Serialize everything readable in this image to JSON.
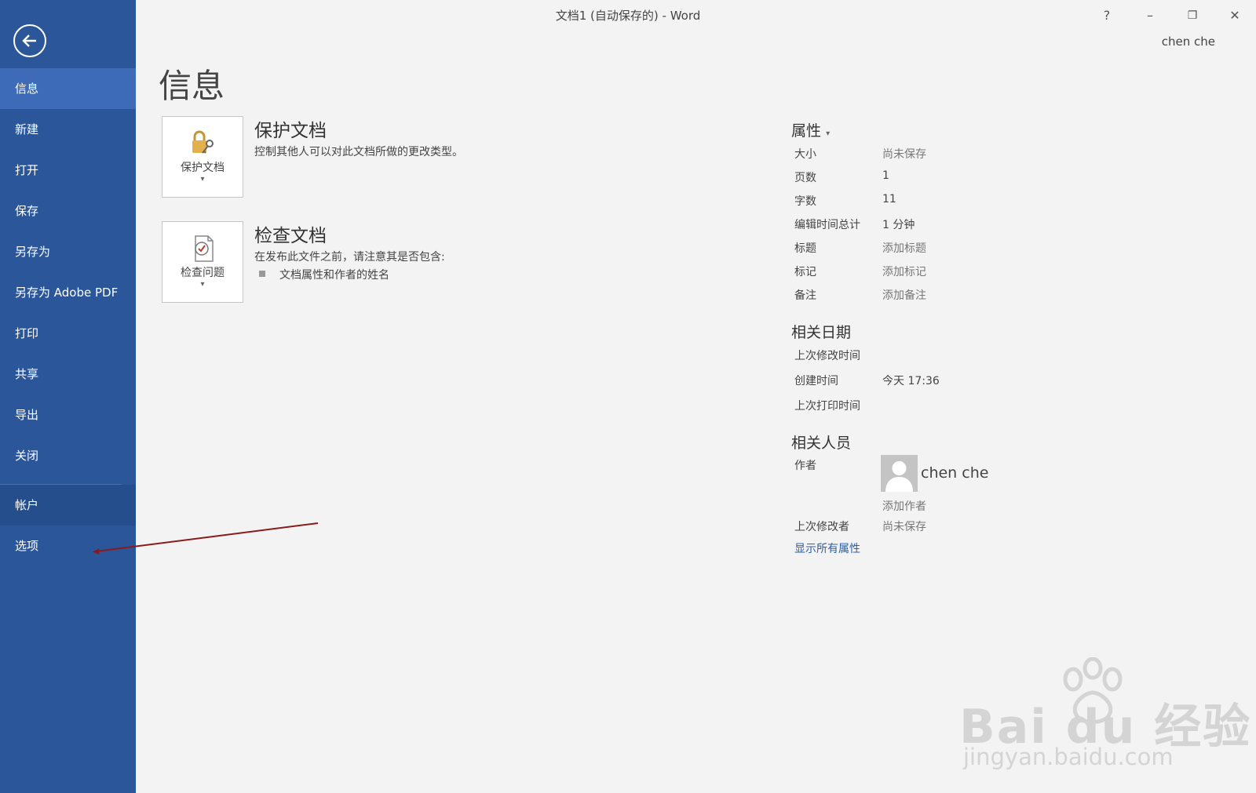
{
  "titlebar": {
    "title": "文档1 (自动保存的) - Word",
    "help": "?",
    "minimize": "–",
    "restore": "❐",
    "close": "✕",
    "user": "chen che"
  },
  "sidebar": {
    "items": [
      {
        "label": "信息"
      },
      {
        "label": "新建"
      },
      {
        "label": "打开"
      },
      {
        "label": "保存"
      },
      {
        "label": "另存为"
      },
      {
        "label": "另存为 Adobe PDF"
      },
      {
        "label": "打印"
      },
      {
        "label": "共享"
      },
      {
        "label": "导出"
      },
      {
        "label": "关闭"
      },
      {
        "label": "帐户"
      },
      {
        "label": "选项"
      }
    ]
  },
  "main": {
    "title": "信息",
    "protect": {
      "tile_label": "保护文档",
      "caret": "▾",
      "heading": "保护文档",
      "desc": "控制其他人可以对此文档所做的更改类型。"
    },
    "inspect": {
      "tile_label": "检查问题",
      "caret": "▾",
      "heading": "检查文档",
      "desc": "在发布此文件之前，请注意其是否包含:",
      "bullet": "文档属性和作者的姓名"
    }
  },
  "properties": {
    "heading": "属性",
    "heading_caret": "▾",
    "rows": [
      {
        "label": "大小",
        "value": "尚未保存"
      },
      {
        "label": "页数",
        "value": "1"
      },
      {
        "label": "字数",
        "value": "11"
      },
      {
        "label": "编辑时间总计",
        "value": "1 分钟"
      },
      {
        "label": "标题",
        "value": "添加标题"
      },
      {
        "label": "标记",
        "value": "添加标记"
      },
      {
        "label": "备注",
        "value": "添加备注"
      }
    ],
    "dates_heading": "相关日期",
    "dates": [
      {
        "label": "上次修改时间",
        "value": ""
      },
      {
        "label": "创建时间",
        "value": "今天 17:36"
      },
      {
        "label": "上次打印时间",
        "value": ""
      }
    ],
    "people_heading": "相关人员",
    "author_label": "作者",
    "author_name": "chen che",
    "add_author": "添加作者",
    "last_modified_by_label": "上次修改者",
    "last_modified_by_value": "尚未保存",
    "show_all": "显示所有属性"
  },
  "watermark": {
    "logo": "Bai  du 经验",
    "url": "jingyan.baidu.com"
  },
  "colors": {
    "sidebar": "#2b579a",
    "sidebar_active": "#3e6bb8",
    "arrow": "#8b1a1a",
    "link": "#2b5fa8"
  }
}
